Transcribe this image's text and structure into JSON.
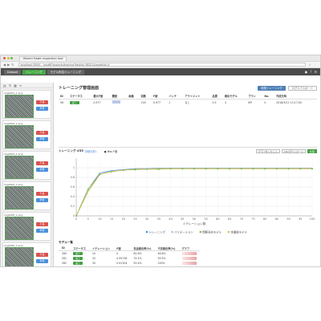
{
  "browser": {
    "tab_title": "Hitachi Hawk Inspection tool",
    "address": "localhost:3000/... jpnaRF/projects/training?taskId=38201&modelId=4"
  },
  "appbar": {
    "crumbs": [
      "Dataset",
      "トレーニング",
      "モデル作成/トレーニング"
    ]
  },
  "sidebar": {
    "items": [
      {
        "name": "img0001_1.png",
        "red": "不良",
        "blue": "学習"
      },
      {
        "name": "img0002_1.png",
        "red": "不良",
        "blue": "学習"
      },
      {
        "name": "img0003_1.png",
        "red": "不良",
        "blue": "学習"
      },
      {
        "name": "img0004_1.png",
        "red": "不良",
        "blue": "学習"
      },
      {
        "name": "img0005_1.png",
        "red": "不良",
        "blue": "学習"
      },
      {
        "name": "img0006_1.png",
        "red": "不良",
        "blue": "学習"
      }
    ]
  },
  "main": {
    "title": "トレーニング管理画面",
    "primary_button": "新規トレーニング",
    "secondary_button": "ログエクスポート",
    "info_headers": [
      "ID",
      "ステータス",
      "最大F値",
      "閾値",
      "画像",
      "回数",
      "F値",
      "バッチ",
      "アライメント",
      "品質",
      "検出モデル",
      "プラン",
      "No.",
      "作成日時"
    ],
    "info_row": [
      "56",
      "完了",
      "0.977",
      "",
      "",
      "100",
      "0.977",
      "1",
      "なし",
      "0.5",
      "4",
      "KPI",
      "0",
      "2018/3/11 15:17:00"
    ]
  },
  "chart_panel": {
    "title": "トレーニング #55",
    "link": "詳細を開く",
    "top_legend": "Max F値",
    "tools": [
      "グラフをリセット",
      "CSVダウンロード",
      "比較"
    ]
  },
  "chart_data": {
    "type": "line",
    "x": [
      0,
      5,
      10,
      15,
      20,
      25,
      30,
      35,
      40,
      45,
      50,
      55,
      60,
      65,
      70,
      75,
      80,
      85,
      90,
      95,
      100
    ],
    "xlabel": "イテレーション数",
    "ylabel": "",
    "ylim": [
      0,
      1.2
    ],
    "yticks": [
      0,
      0.2,
      0.4,
      0.6,
      0.8,
      1
    ],
    "series": [
      {
        "name": "トレーニング",
        "color": "#4a90d9",
        "values": [
          0.0,
          0.55,
          0.89,
          0.94,
          0.96,
          0.98,
          0.98,
          0.99,
          0.99,
          0.99,
          0.99,
          0.99,
          0.99,
          0.99,
          0.99,
          0.99,
          0.99,
          0.99,
          0.99,
          0.99,
          0.99
        ]
      },
      {
        "name": "バリデーション",
        "color": "#9bc8f0",
        "values": [
          0.0,
          0.5,
          0.86,
          0.93,
          0.95,
          0.97,
          0.97,
          0.98,
          0.98,
          0.98,
          0.98,
          0.98,
          0.98,
          0.98,
          0.98,
          0.98,
          0.98,
          0.98,
          0.98,
          0.98,
          0.98
        ]
      },
      {
        "name": "問題多めモデル",
        "color": "#79c05a",
        "values": [
          0.0,
          0.55,
          0.86,
          0.92,
          0.95,
          0.96,
          0.97,
          0.97,
          0.98,
          0.98,
          0.98,
          0.98,
          0.98,
          0.98,
          0.98,
          0.98,
          0.98,
          0.98,
          0.98,
          0.98,
          0.98
        ]
      },
      {
        "name": "本番版モデル",
        "color": "#e4b94a",
        "values": [
          0.0,
          0.5,
          0.86,
          0.92,
          0.95,
          0.97,
          0.97,
          0.98,
          0.98,
          0.98,
          0.98,
          0.98,
          0.98,
          0.98,
          0.98,
          0.98,
          0.98,
          0.98,
          0.98,
          0.98,
          0.98
        ]
      }
    ]
  },
  "models": {
    "title": "モデル一覧",
    "headers": [
      "ID",
      "ステータス",
      "イテレーション",
      "F値",
      "良品検出率(%)",
      "不良検出率(%)",
      "グラフ"
    ],
    "rows": [
      [
        "280",
        "完了",
        "10",
        "0",
        "65.8%",
        "46.8%"
      ],
      [
        "281",
        "完了",
        "20",
        "0.95138",
        "79.2%",
        "93.5%"
      ],
      [
        "282",
        "完了",
        "30",
        "0.91304",
        "93.4%",
        "100%"
      ],
      [
        "283",
        "完了",
        "40",
        "0.96555",
        "95.8%",
        "100%"
      ],
      [
        "284",
        "完了",
        "50",
        "0.96222",
        "97.7%",
        "100%"
      ],
      [
        "285",
        "完了",
        "60",
        "0.9689",
        "97.7%",
        "100%"
      ]
    ]
  }
}
